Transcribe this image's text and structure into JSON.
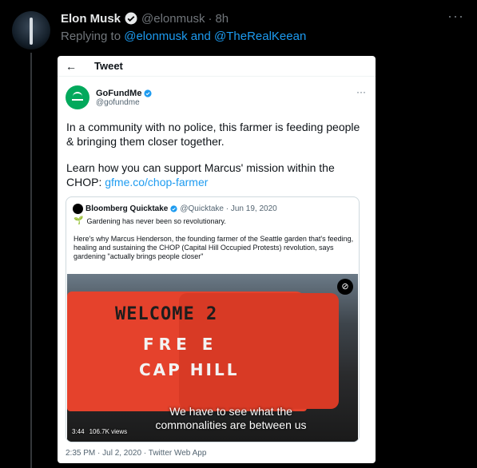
{
  "tweet": {
    "name": "Elon Musk",
    "handle": "@elonmusk",
    "dot": "·",
    "time": "8h",
    "more": "···",
    "replying_prefix": "Replying to ",
    "reply_link": "@elonmusk and @TheRealKeean"
  },
  "screenshot": {
    "back": "←",
    "title": "Tweet",
    "account_name": "GoFundMe",
    "account_handle": "@gofundme",
    "more": "···",
    "paragraph1": "In a community with no police, this farmer is feeding people & bringing them closer together.",
    "paragraph2_text": "Learn how you can support Marcus' mission within the CHOP: ",
    "paragraph2_link": "gfme.co/chop-farmer",
    "quote": {
      "name": "Bloomberg Quicktake",
      "meta": "@Quicktake · Jun 19, 2020",
      "sub": "Gardening has never been  so revolutionary.",
      "text": "Here's why Marcus Henderson, the founding farmer of the Seattle garden that's feeding, healing and sustaining the CHOP (Capital Hill Occupied Protests) revolution, says gardening \"actually brings people closer\"",
      "graffiti_top": "WELCOME 2",
      "graffiti_free": "FRE  E",
      "graffiti_cap": "CAP HILL",
      "caption_line1": "We have to see what the",
      "caption_line2": "commonalities are between us",
      "duration": "3:44",
      "views": "106.7K views"
    },
    "footer": "2:35 PM · Jul 2, 2020 · Twitter Web App"
  },
  "colors": {
    "link": "#1d9bf0",
    "gofundme": "#02a95c",
    "verified": "#1d9bf0"
  }
}
